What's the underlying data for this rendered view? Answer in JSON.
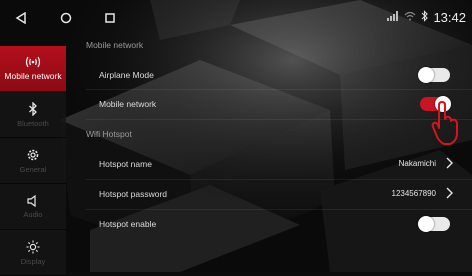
{
  "status": {
    "time": "13:42",
    "network_icon": "signal-4g-icon",
    "wifi_icon": "wifi-icon",
    "bt_icon": "bluetooth-small-icon"
  },
  "sidebar": {
    "items": [
      {
        "label": "Mobile network",
        "icon": "antenna-icon",
        "active": true
      },
      {
        "label": "Bluetooth",
        "icon": "bluetooth-icon",
        "active": false
      },
      {
        "label": "General",
        "icon": "gear-icon",
        "active": false
      },
      {
        "label": "Audio",
        "icon": "speaker-icon",
        "active": false
      },
      {
        "label": "Display",
        "icon": "brightness-icon",
        "active": false
      }
    ]
  },
  "settings": {
    "mobile_network_header": "Mobile network",
    "airplane_mode": {
      "label": "Airplane Mode",
      "enabled": false
    },
    "mobile_network": {
      "label": "Mobile network",
      "enabled": true
    },
    "wifi_hotspot_header": "Wifi Hotspot",
    "hotspot_name": {
      "label": "Hotspot name",
      "value": "Nakamichi"
    },
    "hotspot_password": {
      "label": "Hotspot password",
      "value": "1234567890"
    },
    "hotspot_enable": {
      "label": "Hotspot enable",
      "enabled": false
    }
  },
  "colors": {
    "accent": "#c81620",
    "sidebar_active": "#b40f1c"
  }
}
